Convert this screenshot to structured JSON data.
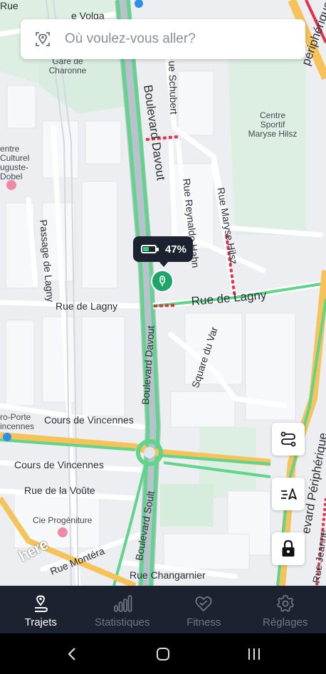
{
  "search": {
    "placeholder": "Où voulez-vous aller?",
    "icon": "location-search-icon"
  },
  "map": {
    "streets": {
      "boulevard_davout_top": "Boulevard Davout",
      "rue_schubert": "ue Schubert",
      "rue_reynaldo_hahn": "Rue Reynaldo Hahn",
      "rue_maryse_hilsz": "Rue Maryse Hilsz",
      "passage_de_lagny": "Passage de Lagny",
      "rue_de_lagny_left": "Rue de Lagny",
      "rue_de_lagny_right": "Rue de Lagny",
      "square_du_var": "Square du Var",
      "boulevard_davout_bottom": "Boulevard Davout",
      "cours_de_vincennes_1": "Cours de Vincennes",
      "cours_de_vincennes_2": "Cours de Vincennes",
      "rue_de_la_voute": "Rue de la Voûte",
      "boulevard_soult": "Boulevard Soult",
      "rue_montera": "Rue Montéra",
      "rue_changarnier": "Rue Changarnier",
      "rue_volga": "e Volga",
      "rue_top_left": "Rue",
      "peripherique_top": "périphérique",
      "peripherique_bottom": "evard Périphérique",
      "rue_jeanne": "Rue Jeanne"
    },
    "pois": {
      "gare_de_charonne": "Gare de\nCharonne",
      "centre_sportif": "Centre\nSportif\nMaryse Hilsz",
      "centre_culturel": "entre\nCulturel\nuguste-\nDobel",
      "porte_vincennes": "ro-Porte\nincennes",
      "cie_progeniture": "Cie Progéniture"
    },
    "provider_logo": "here"
  },
  "scooter": {
    "battery_percent": "47%",
    "battery_level": 0.47,
    "icon": "scooter-icon",
    "status_color": "#1fa56b"
  },
  "map_controls": [
    {
      "name": "route-icon"
    },
    {
      "name": "navigation-assist-icon"
    },
    {
      "name": "lock-icon"
    }
  ],
  "tabs": [
    {
      "label": "Trajets",
      "icon": "trips-icon",
      "active": true
    },
    {
      "label": "Statistiques",
      "icon": "statistics-icon",
      "active": false
    },
    {
      "label": "Fitness",
      "icon": "fitness-heart-icon",
      "active": false
    },
    {
      "label": "Réglages",
      "icon": "settings-gear-icon",
      "active": false
    }
  ],
  "colors": {
    "tabbar_bg": "#1c2230",
    "traffic_free": "#5fd48a",
    "traffic_jam": "#e0334a",
    "accent_green": "#1fa56b",
    "major_road": "#f6c35a"
  }
}
